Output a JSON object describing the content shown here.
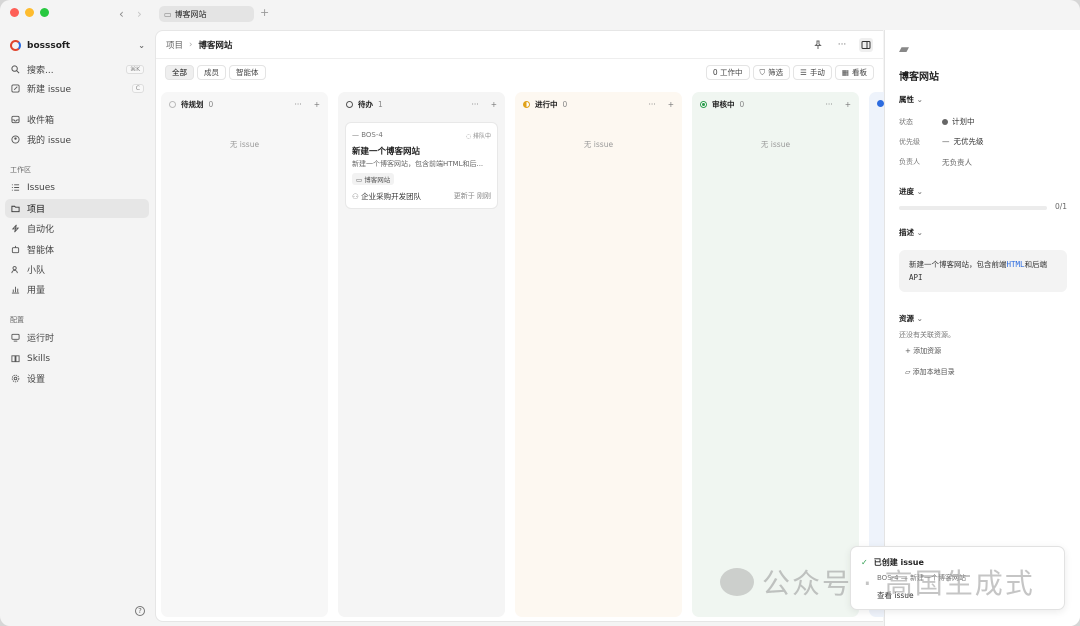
{
  "tab": {
    "label": "博客网站",
    "plus": "+"
  },
  "sidebar": {
    "workspace": "bosssoft",
    "search": {
      "label": "搜索...",
      "shortcut": "⌘K"
    },
    "new_issue": {
      "label": "新建 issue",
      "shortcut": "C"
    },
    "nav": [
      {
        "label": "收件箱",
        "icon": "inbox-icon"
      },
      {
        "label": "我的 issue",
        "icon": "user-circle-icon"
      }
    ],
    "workspace_section": "工作区",
    "workspace_items": [
      {
        "label": "Issues",
        "icon": "list-icon"
      },
      {
        "label": "项目",
        "icon": "folder-icon",
        "active": true
      },
      {
        "label": "自动化",
        "icon": "bolt-icon"
      },
      {
        "label": "智能体",
        "icon": "robot-icon"
      },
      {
        "label": "小队",
        "icon": "team-icon"
      },
      {
        "label": "用量",
        "icon": "bar-chart-icon"
      }
    ],
    "config_section": "配置",
    "config_items": [
      {
        "label": "运行时",
        "icon": "monitor-icon"
      },
      {
        "label": "Skills",
        "icon": "book-icon"
      },
      {
        "label": "设置",
        "icon": "gear-icon"
      }
    ],
    "help": "?"
  },
  "breadcrumb": {
    "parent": "项目",
    "sep": "›",
    "current": "博客网站"
  },
  "filters": [
    "全部",
    "成员",
    "智能体"
  ],
  "tools": {
    "work_count": "0 工作中",
    "filter": "筛选",
    "manual": "手动",
    "board": "看板"
  },
  "columns": [
    {
      "title": "待规划",
      "count": "0",
      "empty": "无 issue",
      "bg": "#f7f7f7",
      "dot": "#bbbbbb"
    },
    {
      "title": "待办",
      "count": "1",
      "empty": "",
      "bg": "#f5f5f5",
      "dot": "#777777"
    },
    {
      "title": "进行中",
      "count": "0",
      "empty": "无 issue",
      "bg": "#fdf8f1",
      "dot": "#e0a21a"
    },
    {
      "title": "审核中",
      "count": "0",
      "empty": "无 issue",
      "bg": "#f0f6f1",
      "dot": "#2e9e4f"
    }
  ],
  "card": {
    "id": "BOS-4",
    "status": "排队中",
    "title": "新建一个博客网站",
    "desc": "新建一个博客网站，包含前端HTML和后...",
    "project": "博客网站",
    "team": "企业采购开发团队",
    "updated": "更新于 刚刚"
  },
  "panel": {
    "title": "博客网站",
    "props_label": "属性",
    "status_key": "状态",
    "status_val": "计划中",
    "priority_key": "优先级",
    "priority_val": "无优先级",
    "owner_key": "负责人",
    "owner_val": "无负责人",
    "progress_label": "进度",
    "progress": "0/1",
    "progress_fraction": 0,
    "desc_label": "描述",
    "desc_a": "新建一个博客网站，包含前端",
    "desc_html": "HTML",
    "desc_b": "和后端",
    "desc_c": "API",
    "resources_label": "资源",
    "no_resources": "还没有关联资源。",
    "add_resource": "添加资源",
    "add_local": "添加本地目录"
  },
  "toast": {
    "title": "已创建 issue",
    "line": "BOS-4 — 新建一个博客网站",
    "action": "查看 issue"
  },
  "watermark": "公众号 · 高国生成式",
  "colors": {
    "accent": "#2d6cdf",
    "active_nav": "#e6e6e6"
  }
}
